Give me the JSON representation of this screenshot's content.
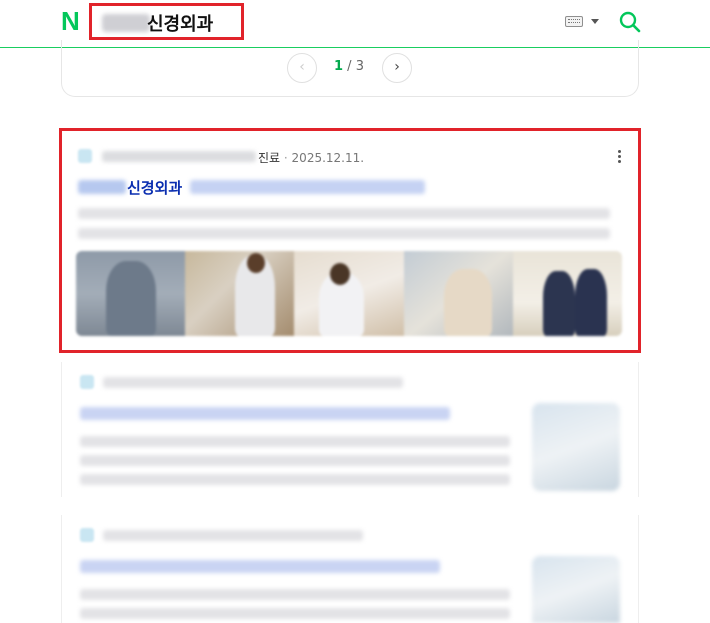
{
  "header": {
    "logo": "N",
    "query_visible": "신경외과",
    "icons": [
      "keyboard-icon",
      "dropdown-caret-icon",
      "search-icon"
    ],
    "accent_color": "#03c75a"
  },
  "pagination": {
    "prev_symbol": "‹",
    "next_symbol": "›",
    "current": "1",
    "separator": " / ",
    "total": "3"
  },
  "result": {
    "source_tail": "진료",
    "separator": " · ",
    "date": "2025.12.11.",
    "title_visible": "신경외과",
    "title_color": "#0a2eb0",
    "highlight_color": "#e1232a"
  }
}
